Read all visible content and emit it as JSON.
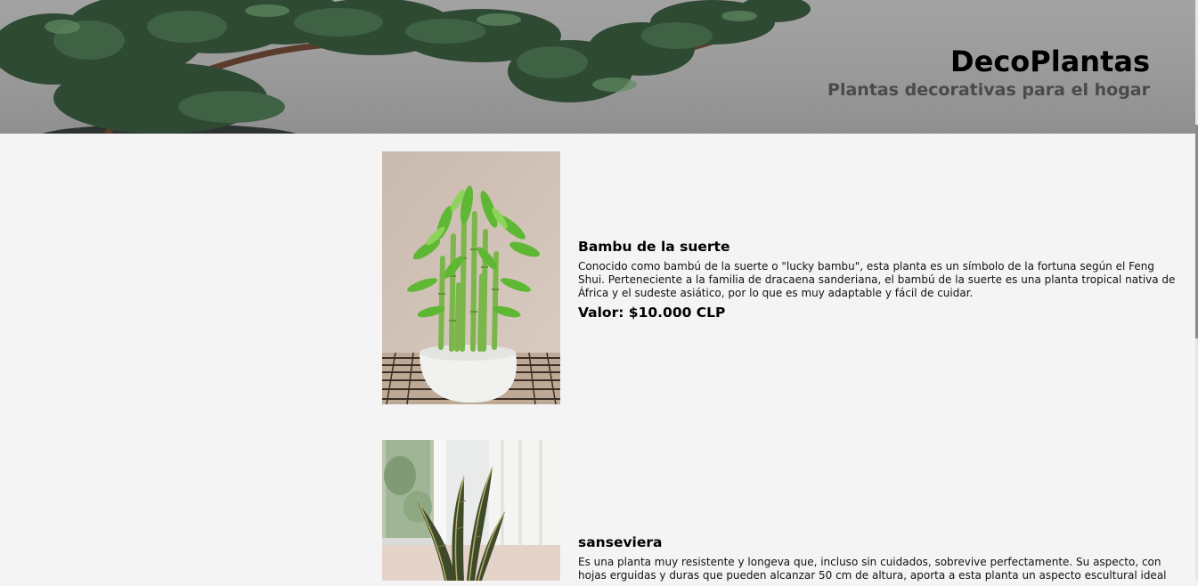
{
  "header": {
    "title": "DecoPlantas",
    "subtitle": "Plantas decorativas para el hogar",
    "background_icon": "pine-branch-photo"
  },
  "products": [
    {
      "name": "Bambu de la suerte",
      "description": "Conocido como bambú de la suerte o \"lucky bambu\", esta planta es un símbolo de la fortuna según el Feng Shui. Perteneciente a la familia de dracaena sanderiana, el bambú de la suerte es una planta tropical nativa de África y el sudeste asiático, por lo que es muy adaptable y fácil de cuidar.",
      "price": "Valor: $10.000 CLP",
      "image_icon": "lucky-bamboo-photo"
    },
    {
      "name": "sanseviera",
      "description": "Es una planta muy resistente y longeva que, incluso sin cuidados, sobrevive perfectamente. Su aspecto, con hojas erguidas y duras que pueden alcanzar 50 cm de altura, aporta a esta planta un aspecto escultural ideal",
      "image_icon": "sansevieria-photo"
    }
  ],
  "colors": {
    "page_background": "#f4f4f4",
    "header_overlay": "#9b9b9b",
    "title": "#000000",
    "subtitle": "#4a4a4a"
  }
}
